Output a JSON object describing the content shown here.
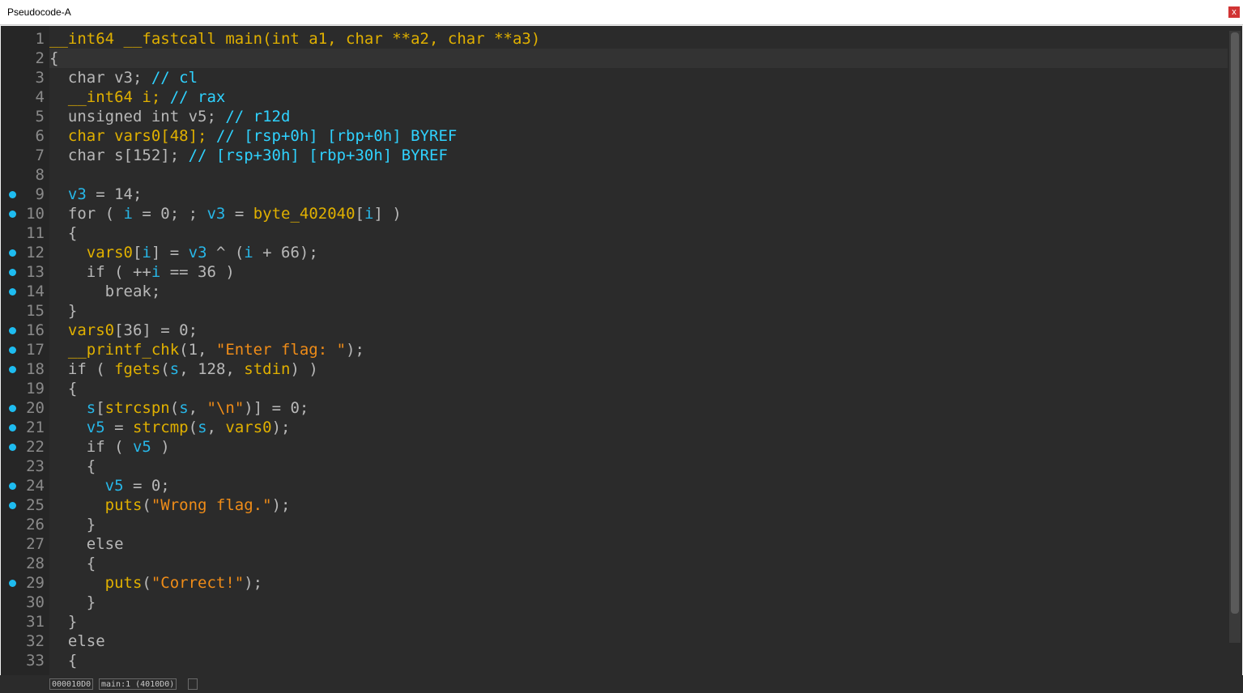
{
  "window": {
    "title": "Pseudocode-A",
    "close_label": "x"
  },
  "code": [
    {
      "n": "1",
      "bp": false,
      "t": [
        [
          "kw",
          "__int64 __fastcall main(int a1, char **a2, char **a3)"
        ]
      ]
    },
    {
      "n": "2",
      "bp": false,
      "t": [
        [
          "txt",
          "{"
        ]
      ]
    },
    {
      "n": "3",
      "bp": false,
      "t": [
        [
          "txt",
          "  char v3; "
        ],
        [
          "cm",
          "// cl"
        ]
      ]
    },
    {
      "n": "4",
      "bp": false,
      "t": [
        [
          "kw",
          "  __int64 i; "
        ],
        [
          "cm",
          "// rax"
        ]
      ]
    },
    {
      "n": "5",
      "bp": false,
      "t": [
        [
          "txt",
          "  unsigned int v5; "
        ],
        [
          "cm",
          "// r12d"
        ]
      ]
    },
    {
      "n": "6",
      "bp": false,
      "t": [
        [
          "kw",
          "  char vars0[48]; "
        ],
        [
          "cm",
          "// [rsp+0h] [rbp+0h] BYREF"
        ]
      ]
    },
    {
      "n": "7",
      "bp": false,
      "t": [
        [
          "txt",
          "  char s[152]; "
        ],
        [
          "cm",
          "// [rsp+30h] [rbp+30h] BYREF"
        ]
      ]
    },
    {
      "n": "8",
      "bp": false,
      "t": [
        [
          "txt",
          ""
        ]
      ]
    },
    {
      "n": "9",
      "bp": true,
      "t": [
        [
          "id",
          "  v3"
        ],
        [
          "txt",
          " = 14;"
        ]
      ]
    },
    {
      "n": "10",
      "bp": true,
      "t": [
        [
          "txt",
          "  for ( "
        ],
        [
          "id",
          "i"
        ],
        [
          "txt",
          " = 0; ; "
        ],
        [
          "id",
          "v3"
        ],
        [
          "txt",
          " = "
        ],
        [
          "kw",
          "byte_402040"
        ],
        [
          "txt",
          "["
        ],
        [
          "id",
          "i"
        ],
        [
          "txt",
          "] )"
        ]
      ]
    },
    {
      "n": "11",
      "bp": false,
      "t": [
        [
          "txt",
          "  {"
        ]
      ]
    },
    {
      "n": "12",
      "bp": true,
      "t": [
        [
          "kw",
          "    vars0"
        ],
        [
          "txt",
          "["
        ],
        [
          "id",
          "i"
        ],
        [
          "txt",
          "] = "
        ],
        [
          "id",
          "v3"
        ],
        [
          "txt",
          " ^ ("
        ],
        [
          "id",
          "i"
        ],
        [
          "txt",
          " + 66);"
        ]
      ]
    },
    {
      "n": "13",
      "bp": true,
      "t": [
        [
          "txt",
          "    if ( ++"
        ],
        [
          "id",
          "i"
        ],
        [
          "txt",
          " == 36 )"
        ]
      ]
    },
    {
      "n": "14",
      "bp": true,
      "t": [
        [
          "txt",
          "      break;"
        ]
      ]
    },
    {
      "n": "15",
      "bp": false,
      "t": [
        [
          "txt",
          "  }"
        ]
      ]
    },
    {
      "n": "16",
      "bp": true,
      "t": [
        [
          "kw",
          "  vars0"
        ],
        [
          "txt",
          "[36] = 0;"
        ]
      ]
    },
    {
      "n": "17",
      "bp": true,
      "t": [
        [
          "kw",
          "  __printf_chk"
        ],
        [
          "txt",
          "(1, "
        ],
        [
          "str",
          "\"Enter flag: \""
        ],
        [
          "txt",
          ");"
        ]
      ]
    },
    {
      "n": "18",
      "bp": true,
      "t": [
        [
          "txt",
          "  if ( "
        ],
        [
          "kw",
          "fgets"
        ],
        [
          "txt",
          "("
        ],
        [
          "id",
          "s"
        ],
        [
          "txt",
          ", 128, "
        ],
        [
          "kw",
          "stdin"
        ],
        [
          "txt",
          ") )"
        ]
      ]
    },
    {
      "n": "19",
      "bp": false,
      "t": [
        [
          "txt",
          "  {"
        ]
      ]
    },
    {
      "n": "20",
      "bp": true,
      "t": [
        [
          "id",
          "    s"
        ],
        [
          "txt",
          "["
        ],
        [
          "kw",
          "strcspn"
        ],
        [
          "txt",
          "("
        ],
        [
          "id",
          "s"
        ],
        [
          "txt",
          ", "
        ],
        [
          "str",
          "\"\\n\""
        ],
        [
          "txt",
          ")] = 0;"
        ]
      ]
    },
    {
      "n": "21",
      "bp": true,
      "t": [
        [
          "id",
          "    v5"
        ],
        [
          "txt",
          " = "
        ],
        [
          "kw",
          "strcmp"
        ],
        [
          "txt",
          "("
        ],
        [
          "id",
          "s"
        ],
        [
          "txt",
          ", "
        ],
        [
          "kw",
          "vars0"
        ],
        [
          "txt",
          ");"
        ]
      ]
    },
    {
      "n": "22",
      "bp": true,
      "t": [
        [
          "txt",
          "    if ( "
        ],
        [
          "id",
          "v5"
        ],
        [
          "txt",
          " )"
        ]
      ]
    },
    {
      "n": "23",
      "bp": false,
      "t": [
        [
          "txt",
          "    {"
        ]
      ]
    },
    {
      "n": "24",
      "bp": true,
      "t": [
        [
          "id",
          "      v5"
        ],
        [
          "txt",
          " = 0;"
        ]
      ]
    },
    {
      "n": "25",
      "bp": true,
      "t": [
        [
          "kw",
          "      puts"
        ],
        [
          "txt",
          "("
        ],
        [
          "str",
          "\"Wrong flag.\""
        ],
        [
          "txt",
          ");"
        ]
      ]
    },
    {
      "n": "26",
      "bp": false,
      "t": [
        [
          "txt",
          "    }"
        ]
      ]
    },
    {
      "n": "27",
      "bp": false,
      "t": [
        [
          "txt",
          "    else"
        ]
      ]
    },
    {
      "n": "28",
      "bp": false,
      "t": [
        [
          "txt",
          "    {"
        ]
      ]
    },
    {
      "n": "29",
      "bp": true,
      "t": [
        [
          "kw",
          "      puts"
        ],
        [
          "txt",
          "("
        ],
        [
          "str",
          "\"Correct!\""
        ],
        [
          "txt",
          ");"
        ]
      ]
    },
    {
      "n": "30",
      "bp": false,
      "t": [
        [
          "txt",
          "    }"
        ]
      ]
    },
    {
      "n": "31",
      "bp": false,
      "t": [
        [
          "txt",
          "  }"
        ]
      ]
    },
    {
      "n": "32",
      "bp": false,
      "t": [
        [
          "txt",
          "  else"
        ]
      ]
    },
    {
      "n": "33",
      "bp": false,
      "t": [
        [
          "txt",
          "  {"
        ]
      ]
    }
  ],
  "status": {
    "address": "000010D0",
    "location": "main:1 (4010D0)"
  },
  "colors": {
    "background": "#2b2b2b",
    "breakpoint": "#1ebcf0",
    "keyword": "#e0b000",
    "string": "#ef8c18",
    "comment": "#2fd2ff"
  }
}
